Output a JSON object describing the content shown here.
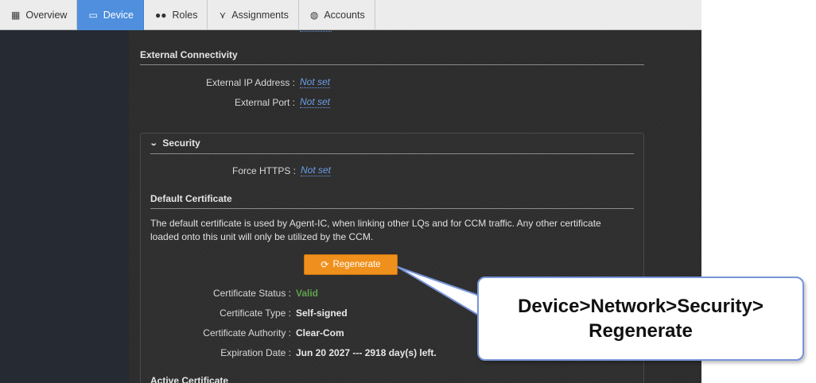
{
  "nav": {
    "tabs": [
      {
        "label": "Overview",
        "icon": "grid-icon",
        "active": false
      },
      {
        "label": "Device",
        "icon": "device-icon",
        "active": true
      },
      {
        "label": "Roles",
        "icon": "users-icon",
        "active": false
      },
      {
        "label": "Assignments",
        "icon": "split-arrow-icon",
        "active": false
      },
      {
        "label": "Accounts",
        "icon": "globe-icon",
        "active": false
      }
    ]
  },
  "external": {
    "title": "External Connectivity",
    "ip_label": "External IP Address :",
    "ip_value": "Not set",
    "port_label": "External Port :",
    "port_value": "Not set"
  },
  "security": {
    "title": "Security",
    "force_https_label": "Force HTTPS :",
    "force_https_value": "Not set",
    "default_cert_title": "Default Certificate",
    "description": "The default certificate is used by Agent-IC, when linking other LQs and for CCM traffic. Any other certificate loaded onto this unit will only be utilized by the CCM.",
    "regenerate_label": "Regenerate",
    "status_label": "Certificate Status :",
    "status_value": "Valid",
    "type_label": "Certificate Type :",
    "type_value": "Self-signed",
    "authority_label": "Certificate Authority :",
    "authority_value": "Clear-Com",
    "expiration_label": "Expiration Date :",
    "expiration_value": "Jun 20 2027 --- 2918 day(s) left.",
    "active_cert_title": "Active Certificate"
  },
  "callout": {
    "line1": "Device>Network>Security>",
    "line2": "Regenerate"
  },
  "colors": {
    "accent": "#4f8fde",
    "button": "#f0901c",
    "valid": "#5fa24f",
    "link": "#6b9de6"
  }
}
